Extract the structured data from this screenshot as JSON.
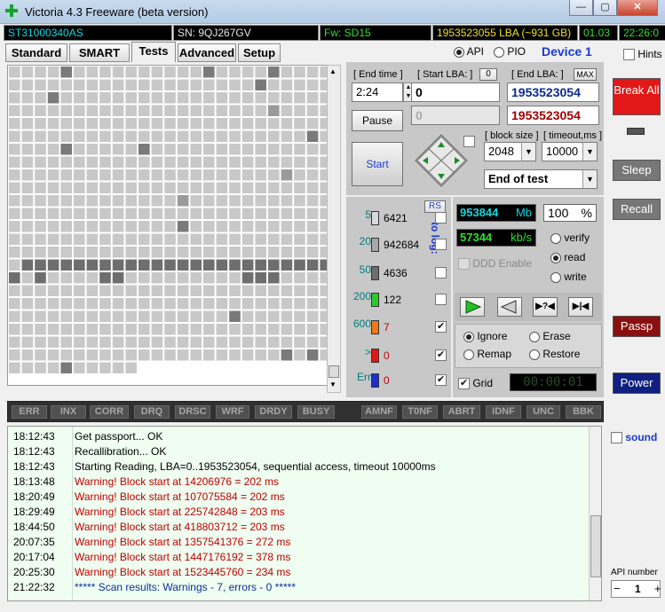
{
  "window": {
    "title": "Victoria 4.3 Freeware (beta version)",
    "minimize": "—",
    "maximize": "▢",
    "close": "✕"
  },
  "status": {
    "model": "ST31000340AS",
    "serial": "SN: 9QJ267GV",
    "firmware": "Fw: SD15",
    "lba": "1953523055 LBA (~931 GB)",
    "version": "01.03",
    "clock": "22:26:0"
  },
  "tabs": [
    "Standard",
    "SMART",
    "Tests",
    "Advanced",
    "Setup"
  ],
  "active_tab": "Tests",
  "mode": {
    "api": "API",
    "pio": "PIO",
    "device": "Device 1",
    "hints": "Hints"
  },
  "controls": {
    "end_time_label": "[ End time ]",
    "end_time": "2:24",
    "start_lba_label": "[ Start LBA: ]",
    "start_lba_btn": "0",
    "start_lba": "0",
    "end_lba_label": "[ End LBA: ]",
    "max": "MAX",
    "end_lba": "1953523054",
    "cur_lba": "0",
    "cur_end_lba": "1953523054",
    "pause": "Pause",
    "start": "Start",
    "block_size_label": "[ block size ]",
    "block_size": "2048",
    "timeout_label": "[ timeout,ms ]",
    "timeout": "10000",
    "end_action": "End of test"
  },
  "legend": {
    "rs": "RS",
    "to_log": "to log:",
    "rows": [
      {
        "label": "5",
        "count": "6421",
        "color": "#d8d8d8",
        "log": false
      },
      {
        "label": "20",
        "count": "942684",
        "color": "#a8a8a8",
        "log": false
      },
      {
        "label": "50",
        "count": "4636",
        "color": "#6e6e6e",
        "log": false
      },
      {
        "label": "200",
        "count": "122",
        "color": "#2ec82e",
        "log": false
      },
      {
        "label": "600",
        "count": "7",
        "color": "#f07818",
        "log": true
      },
      {
        "label": ">",
        "count": "0",
        "color": "#e01818",
        "log": true
      },
      {
        "label": "Err",
        "count": "0",
        "color": "#1c30d0",
        "log": true
      }
    ]
  },
  "stats": {
    "mb": "953844",
    "mb_unit": "Mb",
    "percent": "100",
    "pct_unit": "%",
    "speed": "57344",
    "speed_unit": "kb/s",
    "ddd": "DDD Enable",
    "verify": "verify",
    "read": "read",
    "write": "write"
  },
  "repair": {
    "ignore": "Ignore",
    "erase": "Erase",
    "remap": "Remap",
    "restore": "Restore",
    "grid": "Grid",
    "timer": "00:00:01"
  },
  "errors": [
    "ERR",
    "INX",
    "CORR",
    "DRQ",
    "DRSC",
    "WRF",
    "DRDY",
    "BUSY",
    "AMNF",
    "T0NF",
    "ABRT",
    "IDNF",
    "UNC",
    "BBK"
  ],
  "side": {
    "break": "Break All",
    "sleep": "Sleep",
    "recall": "Recall",
    "passp": "Passp",
    "power": "Power",
    "sound": "sound",
    "api_number": "API number",
    "api_value": "1",
    "minus": "−",
    "plus": "+"
  },
  "log": [
    {
      "time": "18:12:43",
      "msg": "Get passport... OK",
      "type": "info"
    },
    {
      "time": "18:12:43",
      "msg": "Recallibration... OK",
      "type": "info"
    },
    {
      "time": "18:12:43",
      "msg": "Starting Reading, LBA=0..1953523054, sequential access, timeout 10000ms",
      "type": "info"
    },
    {
      "time": "18:13:48",
      "msg": "Warning! Block start at 14206976 = 202 ms",
      "type": "warn"
    },
    {
      "time": "18:20:49",
      "msg": "Warning! Block start at 107075584 = 202 ms",
      "type": "warn"
    },
    {
      "time": "18:29:49",
      "msg": "Warning! Block start at 225742848 = 203 ms",
      "type": "warn"
    },
    {
      "time": "18:44:50",
      "msg": "Warning! Block start at 418803712 = 203 ms",
      "type": "warn"
    },
    {
      "time": "20:07:35",
      "msg": "Warning! Block start at 1357541376 = 272 ms",
      "type": "warn"
    },
    {
      "time": "20:17:04",
      "msg": "Warning! Block start at 1447176192 = 378 ms",
      "type": "warn"
    },
    {
      "time": "20:25:30",
      "msg": "Warning! Block start at 1523445760 = 234 ms",
      "type": "warn"
    },
    {
      "time": "21:22:32",
      "msg": "***** Scan results: Warnings - 7, errors - 0 *****",
      "type": "result"
    }
  ],
  "colors": {
    "warn": "#c00000",
    "result": "#0a2fa0",
    "info": "#000000"
  }
}
